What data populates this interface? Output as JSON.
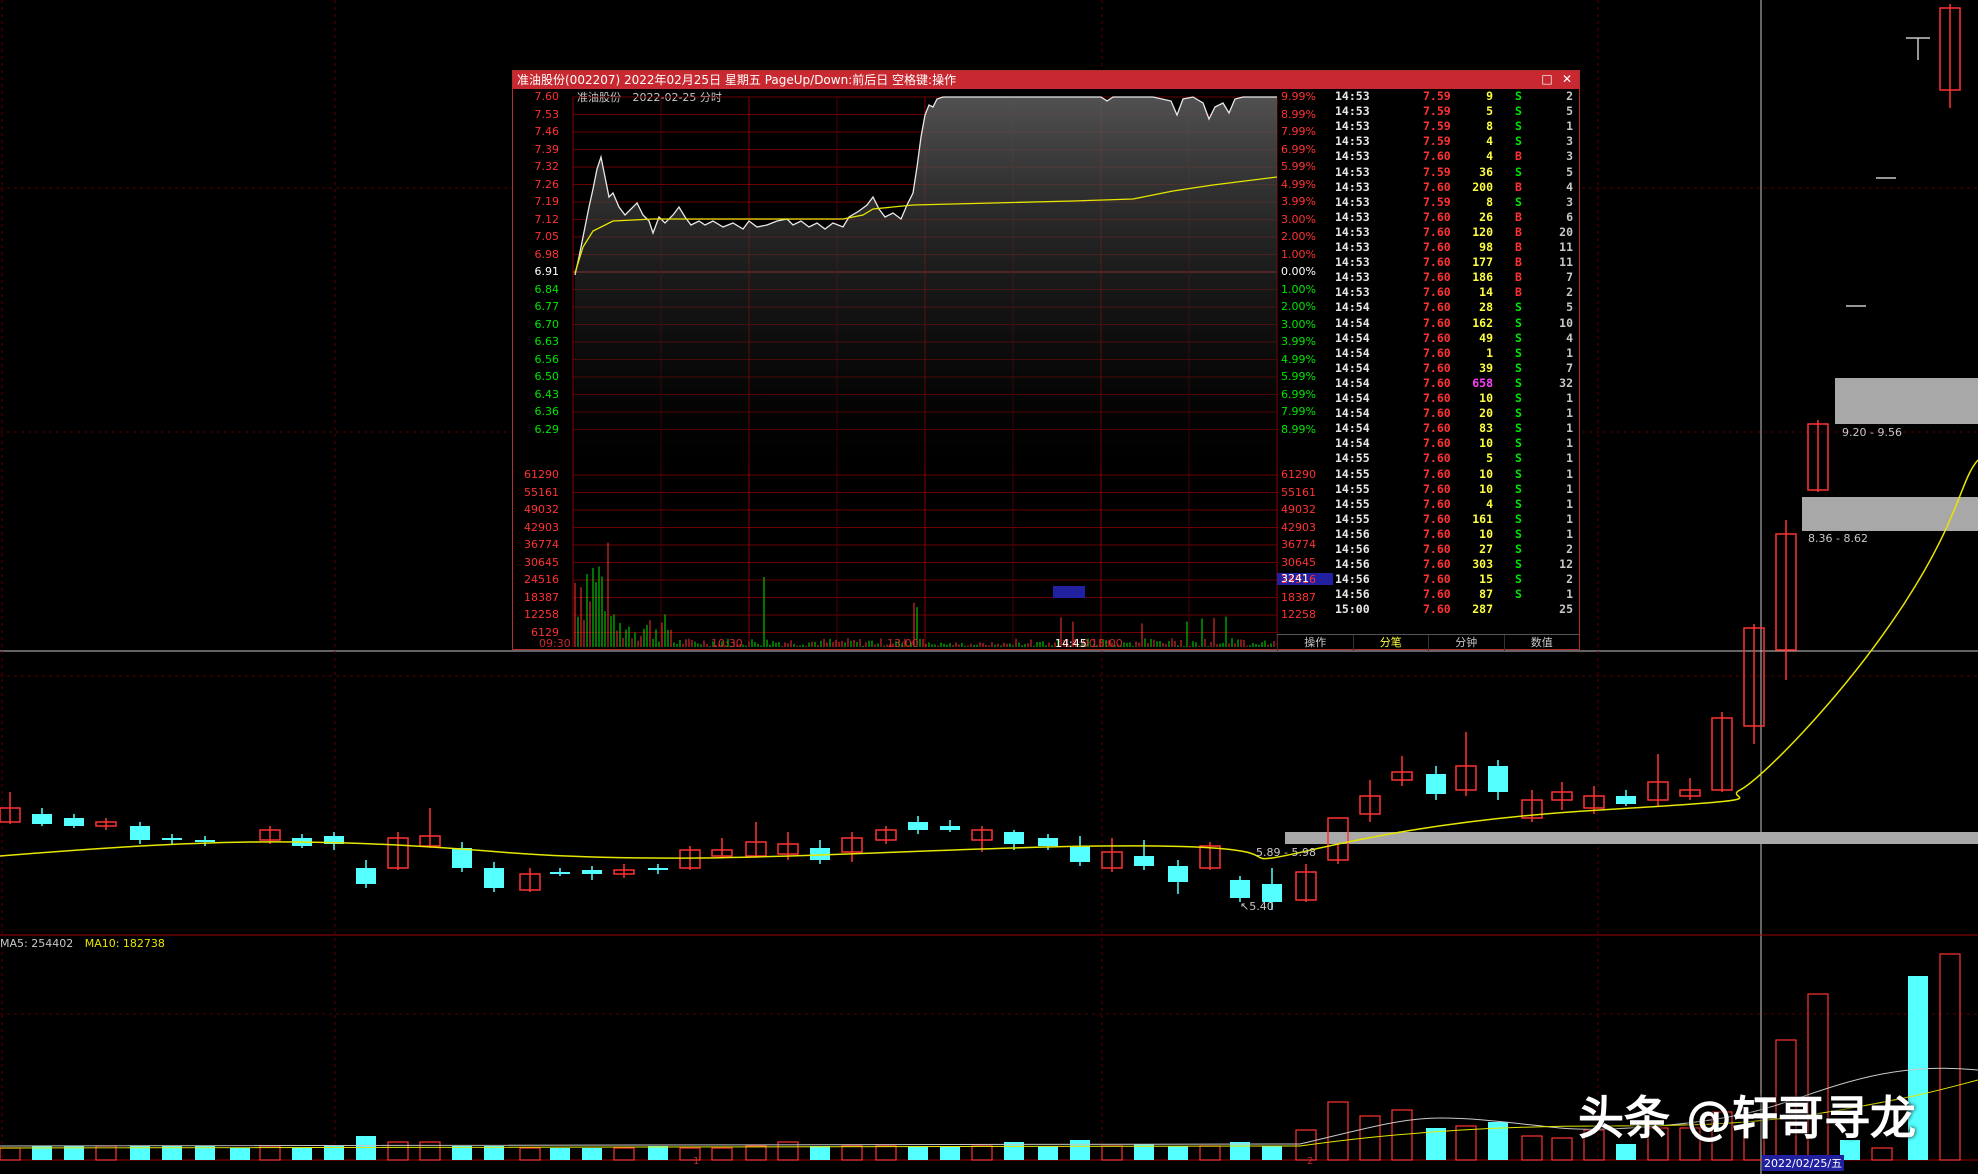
{
  "colors": {
    "up": "#ff3232",
    "down": "#54ffff",
    "ma_line": "#e6e600",
    "grid_red": "#8b0000",
    "title_bar": "#c8282f",
    "buy": "#ff3232",
    "sell": "#00e600",
    "big_vol": "#ff40ff"
  },
  "popup": {
    "title": "准油股份(002207) 2022年02月25日 星期五 PageUp/Down:前后日 空格键:操作",
    "chart_stock": "准油股份",
    "chart_date": "2022-02-25 分时",
    "left_price_ticks": [
      "7.60",
      "7.53",
      "7.46",
      "7.39",
      "7.32",
      "7.26",
      "7.19",
      "7.12",
      "7.05",
      "6.98",
      "6.91",
      "6.84",
      "6.77",
      "6.70",
      "6.63",
      "6.56",
      "6.50",
      "6.43",
      "6.36",
      "6.29"
    ],
    "right_pct_ticks": [
      "9.99%",
      "8.99%",
      "7.99%",
      "6.99%",
      "5.99%",
      "4.99%",
      "3.99%",
      "3.00%",
      "2.00%",
      "1.00%",
      "0.00%",
      "1.00%",
      "2.00%",
      "3.00%",
      "3.99%",
      "4.99%",
      "5.99%",
      "6.99%",
      "7.99%",
      "8.99%"
    ],
    "volume_ticks": [
      "61290",
      "55161",
      "49032",
      "42903",
      "36774",
      "30645",
      "24516",
      "18387",
      "12258",
      "6129"
    ],
    "volume_ticks_right": [
      "61290",
      "55161",
      "49032",
      "42903",
      "36774",
      "30645",
      "24516",
      "18387",
      "12258"
    ],
    "current_volume": "3241",
    "time_labels": [
      "09:30",
      "10:30",
      "13:00",
      "14:00",
      "14:45",
      "15:00"
    ],
    "tabs": [
      "操作",
      "分笔",
      "分钟",
      "数值"
    ],
    "trades": [
      {
        "t": "14:53",
        "p": "7.59",
        "v": "9",
        "bs": "S",
        "n": "2"
      },
      {
        "t": "14:53",
        "p": "7.59",
        "v": "5",
        "bs": "S",
        "n": "5"
      },
      {
        "t": "14:53",
        "p": "7.59",
        "v": "8",
        "bs": "S",
        "n": "1"
      },
      {
        "t": "14:53",
        "p": "7.59",
        "v": "4",
        "bs": "S",
        "n": "3"
      },
      {
        "t": "14:53",
        "p": "7.60",
        "v": "4",
        "bs": "B",
        "n": "3"
      },
      {
        "t": "14:53",
        "p": "7.59",
        "v": "36",
        "bs": "S",
        "n": "5"
      },
      {
        "t": "14:53",
        "p": "7.60",
        "v": "200",
        "bs": "B",
        "n": "4"
      },
      {
        "t": "14:53",
        "p": "7.59",
        "v": "8",
        "bs": "S",
        "n": "3"
      },
      {
        "t": "14:53",
        "p": "7.60",
        "v": "26",
        "bs": "B",
        "n": "6"
      },
      {
        "t": "14:53",
        "p": "7.60",
        "v": "120",
        "bs": "B",
        "n": "20"
      },
      {
        "t": "14:53",
        "p": "7.60",
        "v": "98",
        "bs": "B",
        "n": "11"
      },
      {
        "t": "14:53",
        "p": "7.60",
        "v": "177",
        "bs": "B",
        "n": "11"
      },
      {
        "t": "14:53",
        "p": "7.60",
        "v": "186",
        "bs": "B",
        "n": "7"
      },
      {
        "t": "14:53",
        "p": "7.60",
        "v": "14",
        "bs": "B",
        "n": "2"
      },
      {
        "t": "14:54",
        "p": "7.60",
        "v": "28",
        "bs": "S",
        "n": "5"
      },
      {
        "t": "14:54",
        "p": "7.60",
        "v": "162",
        "bs": "S",
        "n": "10"
      },
      {
        "t": "14:54",
        "p": "7.60",
        "v": "49",
        "bs": "S",
        "n": "4"
      },
      {
        "t": "14:54",
        "p": "7.60",
        "v": "1",
        "bs": "S",
        "n": "1"
      },
      {
        "t": "14:54",
        "p": "7.60",
        "v": "39",
        "bs": "S",
        "n": "7"
      },
      {
        "t": "14:54",
        "p": "7.60",
        "v": "658",
        "bs": "S",
        "n": "32"
      },
      {
        "t": "14:54",
        "p": "7.60",
        "v": "10",
        "bs": "S",
        "n": "1"
      },
      {
        "t": "14:54",
        "p": "7.60",
        "v": "20",
        "bs": "S",
        "n": "1"
      },
      {
        "t": "14:54",
        "p": "7.60",
        "v": "83",
        "bs": "S",
        "n": "1"
      },
      {
        "t": "14:54",
        "p": "7.60",
        "v": "10",
        "bs": "S",
        "n": "1"
      },
      {
        "t": "14:55",
        "p": "7.60",
        "v": "5",
        "bs": "S",
        "n": "1"
      },
      {
        "t": "14:55",
        "p": "7.60",
        "v": "10",
        "bs": "S",
        "n": "1"
      },
      {
        "t": "14:55",
        "p": "7.60",
        "v": "10",
        "bs": "S",
        "n": "1"
      },
      {
        "t": "14:55",
        "p": "7.60",
        "v": "4",
        "bs": "S",
        "n": "1"
      },
      {
        "t": "14:55",
        "p": "7.60",
        "v": "161",
        "bs": "S",
        "n": "1"
      },
      {
        "t": "14:56",
        "p": "7.60",
        "v": "10",
        "bs": "S",
        "n": "1"
      },
      {
        "t": "14:56",
        "p": "7.60",
        "v": "27",
        "bs": "S",
        "n": "2"
      },
      {
        "t": "14:56",
        "p": "7.60",
        "v": "303",
        "bs": "S",
        "n": "12"
      },
      {
        "t": "14:56",
        "p": "7.60",
        "v": "15",
        "bs": "S",
        "n": "2"
      },
      {
        "t": "14:56",
        "p": "7.60",
        "v": "87",
        "bs": "S",
        "n": "1"
      },
      {
        "t": "15:00",
        "p": "7.60",
        "v": "287",
        "bs": "",
        "n": "25"
      }
    ]
  },
  "main_chart": {
    "marks": {
      "m1": "9.20 - 9.56",
      "m2": "8.36 - 8.62",
      "m3": "5.89 - 5.98",
      "m4": "5.40"
    },
    "volume_ma": {
      "ma5_label": "MA5: 254402",
      "ma10_label": "MA10: 182738"
    },
    "x_marks": [
      "1",
      "2"
    ],
    "date_tag": "2022/02/25/五"
  },
  "watermark": "头条 @轩哥寻龙",
  "chart_data": {
    "type": "line",
    "title": "准油股份 2022-02-25 分时",
    "prev_close": 6.91,
    "ylim": [
      6.22,
      7.6
    ],
    "x": [
      "09:30",
      "10:30",
      "13:00",
      "14:00",
      "15:00"
    ],
    "series": [
      {
        "values": [
          6.78,
          7.05,
          7.24,
          7.1,
          7.06,
          7.0,
          6.98,
          7.01,
          7.08,
          7.6,
          7.6,
          7.56,
          7.6,
          7.6
        ]
      },
      {
        "values": [
          6.78,
          6.97,
          7.03,
          7.03,
          7.03,
          7.04,
          7.04,
          7.05,
          7.12,
          7.14,
          7.17,
          7.2,
          7.24,
          7.25
        ]
      }
    ]
  }
}
